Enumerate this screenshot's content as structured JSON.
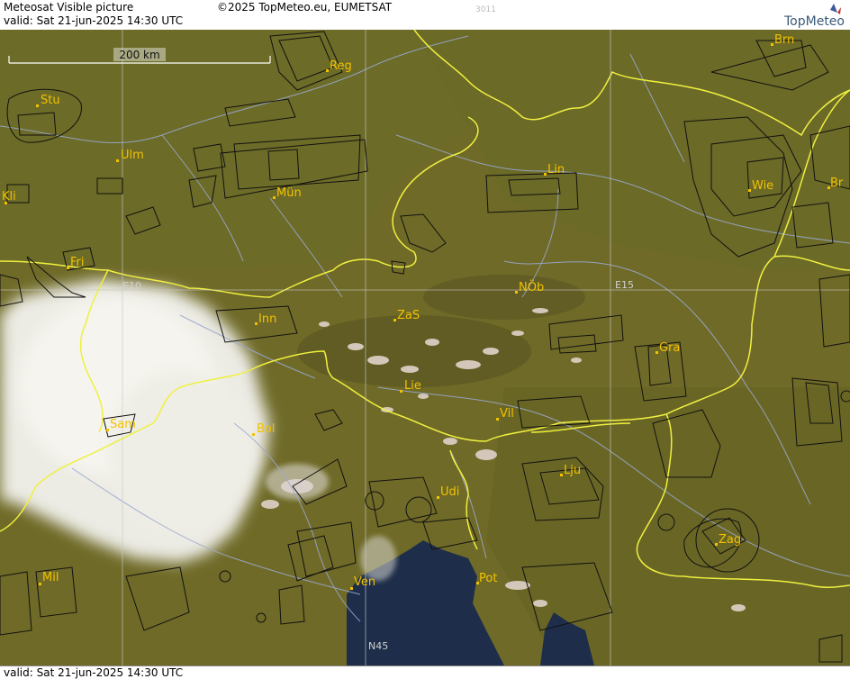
{
  "header": {
    "title": "Meteosat Visible picture",
    "copyright": "©2025 TopMeteo.eu, EUMETSAT",
    "image_code": "3011",
    "valid": "valid:  Sat  21-jun-2025  14:30 UTC",
    "logo_text": "TopMeteo"
  },
  "footer": {
    "valid": "valid:  Sat  21-jun-2025  14:30 UTC"
  },
  "scale_bar": {
    "label": "200 km"
  },
  "grid_labels": {
    "e10": "E10",
    "e15": "E15",
    "n45": "N45"
  },
  "cities": [
    {
      "name": "Reg"
    },
    {
      "name": "Brn"
    },
    {
      "name": "Stu"
    },
    {
      "name": "Ulm"
    },
    {
      "name": "Lin"
    },
    {
      "name": "Wie"
    },
    {
      "name": "Br"
    },
    {
      "name": "Kli"
    },
    {
      "name": "Mün"
    },
    {
      "name": "Fri"
    },
    {
      "name": "NÖb"
    },
    {
      "name": "Inn"
    },
    {
      "name": "ZaS"
    },
    {
      "name": "Gra"
    },
    {
      "name": "Lie"
    },
    {
      "name": "Vil"
    },
    {
      "name": "Sam"
    },
    {
      "name": "Bol"
    },
    {
      "name": "Lju"
    },
    {
      "name": "Udi"
    },
    {
      "name": "Zag"
    },
    {
      "name": "Mil"
    },
    {
      "name": "Pot"
    },
    {
      "name": "Ven"
    }
  ],
  "colors": {
    "land": "#6f6a27",
    "land_dark": "#5a5a20",
    "sea": "#1e2e4a",
    "border": "#f0f040",
    "river": "#9aa8d0",
    "airspace": "#111111",
    "city_label": "#f2c200",
    "cloud": "#ecebe4"
  }
}
